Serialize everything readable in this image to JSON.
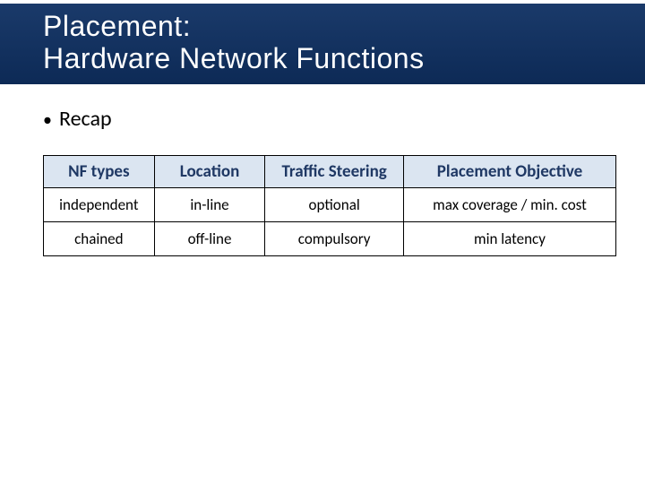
{
  "title": {
    "line1": "Placement:",
    "line2": "Hardware Network Functions"
  },
  "bullet": "Recap",
  "table": {
    "headers": [
      "NF types",
      "Location",
      "Traffic Steering",
      "Placement Objective"
    ],
    "rows": [
      [
        "independent",
        "in-line",
        "optional",
        "max coverage / min. cost"
      ],
      [
        "chained",
        "off-line",
        "compulsory",
        "min latency"
      ]
    ]
  }
}
